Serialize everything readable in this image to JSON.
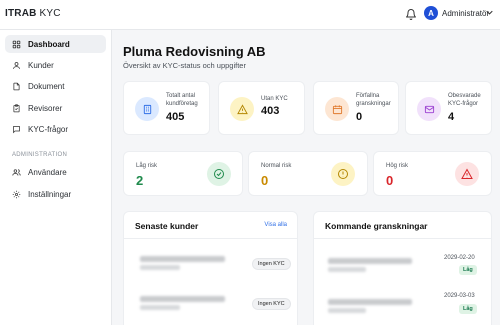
{
  "app": {
    "brand_bold": "ITRAB",
    "brand_rest": " KYC"
  },
  "header": {
    "avatar_initial": "A",
    "user_name": "Administratör"
  },
  "sidebar": {
    "items": [
      {
        "label": "Dashboard",
        "icon": "dashboard-icon",
        "active": true
      },
      {
        "label": "Kunder",
        "icon": "user-icon"
      },
      {
        "label": "Dokument",
        "icon": "document-icon"
      },
      {
        "label": "Revisorer",
        "icon": "clipboard-icon"
      },
      {
        "label": "KYC-frågor",
        "icon": "chat-icon"
      }
    ],
    "admin_section_label": "ADMINISTRATION",
    "admin_items": [
      {
        "label": "Användare",
        "icon": "users-icon"
      },
      {
        "label": "Inställningar",
        "icon": "gear-icon"
      }
    ]
  },
  "page": {
    "title": "Pluma Redovisning AB",
    "subtitle": "Översikt av KYC-status och uppgifter"
  },
  "stats": [
    {
      "label_line1": "Totalt antal",
      "label_line2": "kundföretag",
      "value": "405",
      "icon": "building-icon",
      "color": "#dbe9ff",
      "icon_color": "#2f6fe6"
    },
    {
      "label_line1": "Utan KYC",
      "label_line2": "",
      "value": "403",
      "icon": "warning-icon",
      "color": "#fdf3c4",
      "icon_color": "#b38600"
    },
    {
      "label_line1": "Förfallna",
      "label_line2": "granskningar",
      "value": "0",
      "icon": "calendar-icon",
      "color": "#fde6d3",
      "icon_color": "#e07a2e"
    },
    {
      "label_line1": "Obesvarade",
      "label_line2": "KYC-frågor",
      "value": "4",
      "icon": "mail-icon",
      "color": "#f1e1fb",
      "icon_color": "#9b3fd1"
    }
  ],
  "risk": [
    {
      "label": "Låg risk",
      "value": "2",
      "color": "#1f8a4c",
      "icon_bg": "#dff3e5",
      "icon": "check-circle-icon"
    },
    {
      "label": "Normal risk",
      "value": "0",
      "color": "#c98a00",
      "icon_bg": "#fdf3c4",
      "icon": "alert-circle-icon"
    },
    {
      "label": "Hög risk",
      "value": "0",
      "color": "#d9262b",
      "icon_bg": "#fde2e2",
      "icon": "warning-icon"
    }
  ],
  "recent_customers": {
    "title": "Senaste kunder",
    "link": "Visa alla",
    "rows": [
      {
        "status": "Ingen KYC"
      },
      {
        "status": "Ingen KYC"
      }
    ]
  },
  "upcoming_reviews": {
    "title": "Kommande granskningar",
    "rows": [
      {
        "date": "2029-02-20",
        "risk": "Låg"
      },
      {
        "date": "2029-03-03",
        "risk": "Låg"
      }
    ]
  }
}
